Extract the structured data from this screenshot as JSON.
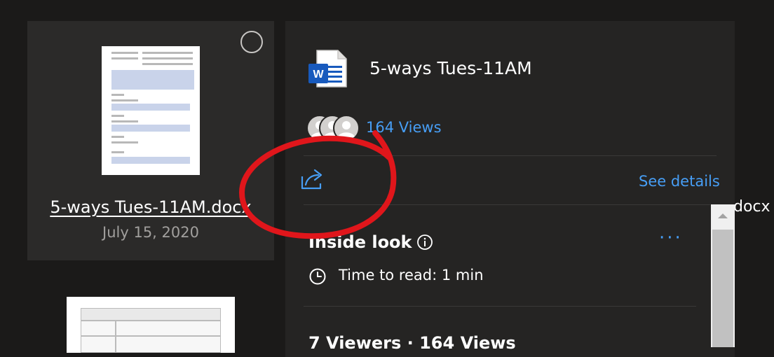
{
  "file_card": {
    "name": "5-ways Tues-11AM.docx",
    "date": "July 15, 2020"
  },
  "details": {
    "title": "5-ways Tues-11AM",
    "views_link": "164 Views",
    "see_details": "See details",
    "overflow_text": "docx",
    "inside_look_title": "Inside look",
    "more_label": "···",
    "read_time": "Time to read: 1 min",
    "viewers_summary": "7 Viewers · 164 Views"
  },
  "icons": {
    "file_type": "word-doc-icon",
    "share": "share-icon",
    "info": "info-icon",
    "clock": "clock-icon",
    "select": "select-circle-icon"
  },
  "colors": {
    "background": "#1b1a19",
    "card": "#2b2a29",
    "panel": "#252423",
    "link": "#479ef5",
    "annotation": "#e0161b",
    "word_blue": "#185abd"
  }
}
